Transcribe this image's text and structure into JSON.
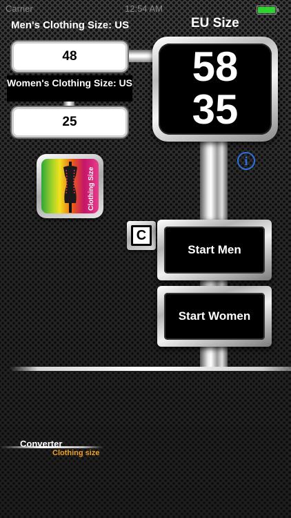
{
  "status_bar": {
    "carrier": "Carrier",
    "time": "12:54 AM"
  },
  "labels": {
    "mens_size_label": "Men's Clothing Size: US",
    "womens_size_label": "Women's Clothing Size: US",
    "eu_size_label": "EU Size"
  },
  "inputs": {
    "mens_value": "48",
    "womens_value": "25"
  },
  "eu_display": {
    "men_value": "58",
    "women_value": "35"
  },
  "app_icon": {
    "caption": "Clothing Size"
  },
  "buttons": {
    "clear_label": "C",
    "start_men_label": "Start Men",
    "start_women_label": "Start Women",
    "info_glyph": "i"
  },
  "footer_logo": {
    "title": "Converter",
    "subtitle": "Clothing size"
  },
  "colors": {
    "info_blue": "#2e6fe0",
    "logo_orange": "#f0a020",
    "battery_green": "#2fd32f"
  },
  "icons": {
    "info": "info-circle-icon",
    "battery": "battery-icon",
    "app": "mannequin-icon"
  }
}
